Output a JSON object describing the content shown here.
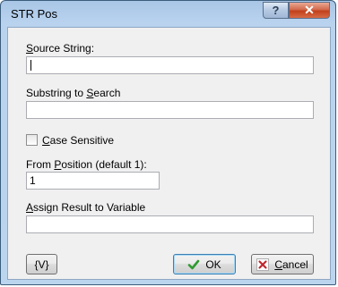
{
  "window": {
    "title": "STR Pos",
    "help_glyph": "?",
    "close_glyph": "✕"
  },
  "form": {
    "source_string": {
      "label_pre": "",
      "label_key": "S",
      "label_post": "ource String:",
      "value": ""
    },
    "substring": {
      "label_pre": "Substring to ",
      "label_key": "S",
      "label_post": "earch",
      "value": ""
    },
    "case_sensitive": {
      "label_pre": "",
      "label_key": "C",
      "label_post": "ase Sensitive",
      "checked": false
    },
    "from_position": {
      "label_pre": "From ",
      "label_key": "P",
      "label_post": "osition (default 1):",
      "value": "1"
    },
    "assign_result": {
      "label_pre": "",
      "label_key": "A",
      "label_post": "ssign Result to Variable",
      "value": ""
    }
  },
  "buttons": {
    "variables_label": "{V}",
    "ok_label": "OK",
    "ok_key": "",
    "cancel_pre": "",
    "cancel_key": "C",
    "cancel_post": "ancel"
  },
  "icons": {
    "ok": "green-checkmark-icon",
    "cancel": "red-x-icon"
  },
  "colors": {
    "ok_icon": "#2f9a2f",
    "cancel_icon": "#c0272d",
    "close_button": "#c7472a"
  }
}
